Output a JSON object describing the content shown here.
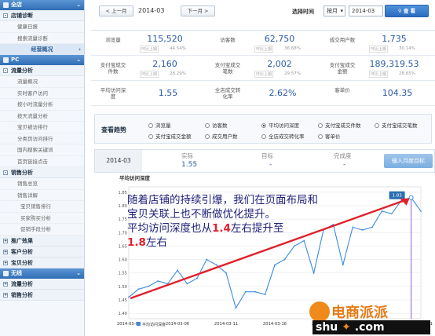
{
  "sidebar": {
    "shop_header": "全店",
    "shop_group": "店铺诊断",
    "shop_items": [
      "健康日报",
      "搜索流量诊断"
    ],
    "shop_blue": "经营概况",
    "pc_header": "PC",
    "traffic_group": "流量分析",
    "traffic_items": [
      "流量概况",
      "实时客户访问",
      "按小时流量分析",
      "按天流量分析",
      "宝贝被访排行",
      "分类页访问排行",
      "国内搜索关键词",
      "首页链接点击"
    ],
    "sales_group": "销售分析",
    "sales_items": [
      "销售总览",
      "销售详解"
    ],
    "sales_sub_items": [
      "宝贝销售排行",
      "买家购买分析",
      "促销手段分析"
    ],
    "promo_group": "推广效果",
    "customer_group": "客户分析",
    "baby_group": "宝贝分析",
    "wireless_header": "无线",
    "w_traffic_group": "流量分析",
    "w_sales_group": "销售分析"
  },
  "topbar": {
    "prev_label": "< 上一月",
    "month_value": "2014-03",
    "next_label": "下一月 >",
    "select_time_label": "选择时间",
    "unit_value": "按月",
    "date_value": "2014-03",
    "search_label": "查 看"
  },
  "stats": [
    {
      "label": "浏览量",
      "value": "115,520",
      "cmp": "环比上期",
      "pct": "44.54%",
      "up": true
    },
    {
      "label": "访客数",
      "value": "62,750",
      "cmp": "环比上期",
      "pct": "36.68%",
      "up": true
    },
    {
      "label": "成交用户数",
      "value": "1,735",
      "cmp": "环比上期",
      "pct": "30.14%",
      "up": true
    },
    {
      "label": "支付宝成交件数",
      "value": "2,160",
      "cmp": "环比上期",
      "pct": "28.29%",
      "up": true
    },
    {
      "label": "支付宝成交笔数",
      "value": "2,002",
      "cmp": "环比上期",
      "pct": "29.57%",
      "up": true
    },
    {
      "label": "支付宝成交金额",
      "value": "189,319.53",
      "cmp": "环比上期",
      "pct": "28.65%",
      "up": true
    },
    {
      "label": "平均访问深度",
      "value": "1.55"
    },
    {
      "label": "全店成交转化率",
      "value": "2.62%"
    },
    {
      "label": "客单价",
      "value": "104.35"
    }
  ],
  "trend": {
    "title": "查看趋势",
    "options": [
      "浏览量",
      "访客数",
      "平均访问深度",
      "支付宝成交件数",
      "支付宝成交笔数",
      "支付宝成交金额",
      "成交用户数",
      "全店成交转化率",
      "客单价"
    ],
    "selected": "平均访问深度"
  },
  "target_row": {
    "month": "2014-03",
    "actual_label": "实际",
    "actual_value": "1.55",
    "target_label": "目标",
    "target_value": "-",
    "completion_label": "完成度",
    "completion_value": "-",
    "input_button": "输入月度目标"
  },
  "annotation": {
    "line1": "随着店铺的持续引爆，我们在页面布局和",
    "line2": "宝贝关联上也不断做优化提升。",
    "line3a": "平均访问深度也从",
    "line3b": "1.4",
    "line3c": "左右提升至",
    "line4": "1.8",
    "line4b": "左右"
  },
  "watermark": {
    "text1": "电商派派",
    "text2": "shu",
    "text3": ".com"
  },
  "chart_data": {
    "type": "line",
    "title": "平均访问深度",
    "x": [
      "2014-03-01",
      "2014-03-02",
      "2014-03-03",
      "2014-03-04",
      "2014-03-05",
      "2014-03-06",
      "2014-03-07",
      "2014-03-08",
      "2014-03-09",
      "2014-03-10",
      "2014-03-11",
      "2014-03-12",
      "2014-03-13",
      "2014-03-14",
      "2014-03-15",
      "2014-03-16",
      "2014-03-17",
      "2014-03-18",
      "2014-03-19",
      "2014-03-20",
      "2014-03-21",
      "2014-03-22",
      "2014-03-23",
      "2014-03-24",
      "2014-03-25",
      "2014-03-26",
      "2014-03-27",
      "2014-03-28",
      "2014-03-29",
      "2014-03-30",
      "2014-03-31"
    ],
    "xtick_labels": [
      "2014-03-01",
      "2014-03-06",
      "2014-03-11",
      "2014-03-16",
      "2014-03-21",
      "2014-03-26",
      "2014-03-31"
    ],
    "series": [
      {
        "name": "平均访问深度",
        "values": [
          1.46,
          1.49,
          1.5,
          1.52,
          1.51,
          1.56,
          1.51,
          1.53,
          1.6,
          1.58,
          1.55,
          1.42,
          1.48,
          1.48,
          1.47,
          1.58,
          1.6,
          1.65,
          1.67,
          1.55,
          1.71,
          1.73,
          1.58,
          1.72,
          1.71,
          1.72,
          1.78,
          1.77,
          1.82,
          1.83,
          1.78
        ]
      }
    ],
    "tooltip": {
      "x": "2014-03-30",
      "value": "1.83"
    },
    "yticks": [
      1.4,
      1.45,
      1.5,
      1.55,
      1.6,
      1.65,
      1.7,
      1.75,
      1.8,
      1.85
    ],
    "ylim": [
      1.38,
      1.87
    ],
    "grid": true,
    "color": "#3a8be0"
  }
}
